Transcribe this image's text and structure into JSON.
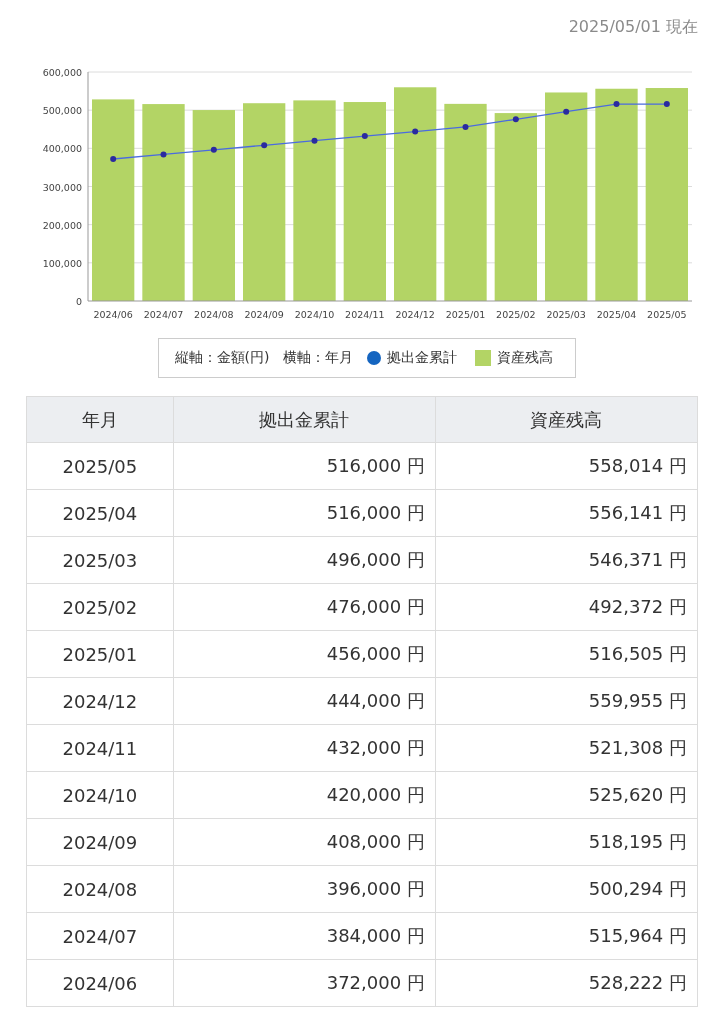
{
  "as_of": "2025/05/01 現在",
  "chart": {
    "chart_data": {
      "type": "bar",
      "categories": [
        "2024/06",
        "2024/07",
        "2024/08",
        "2024/09",
        "2024/10",
        "2024/11",
        "2024/12",
        "2025/01",
        "2025/02",
        "2025/03",
        "2025/04",
        "2025/05"
      ],
      "series": [
        {
          "name": "拠出金累計",
          "color": "#2a2aa0",
          "type": "line",
          "marker": true,
          "values": [
            372000,
            384000,
            396000,
            408000,
            420000,
            432000,
            444000,
            456000,
            476000,
            496000,
            516000,
            516000
          ]
        },
        {
          "name": "資産残高",
          "color": "#b3d465",
          "values": [
            528222,
            515964,
            500294,
            518195,
            525620,
            521308,
            559955,
            516505,
            492372,
            546371,
            556141,
            558014
          ]
        }
      ],
      "stacked": false,
      "grid": true,
      "ylim": [
        0,
        600000
      ],
      "yticks": [
        {
          "value": 0,
          "label": "0"
        },
        {
          "value": 100000,
          "label": "100,000"
        },
        {
          "value": 200000,
          "label": "200,000"
        },
        {
          "value": 300000,
          "label": "300,000"
        },
        {
          "value": 400000,
          "label": "400,000"
        },
        {
          "value": 500000,
          "label": "500,000"
        },
        {
          "value": 600000,
          "label": "600,000"
        }
      ]
    },
    "legend": {
      "notes": [
        "縦軸：金額(円)",
        "横軸：年月"
      ],
      "items": [
        {
          "kind": "dot",
          "color": "#1565c0"
        },
        {
          "kind": "square",
          "color": "#b3d465"
        }
      ]
    }
  },
  "table": {
    "columns": [
      "年月",
      "拠出金累計",
      "資産残高"
    ],
    "rows": [
      [
        "2025/05",
        "516,000 円",
        "558,014 円"
      ],
      [
        "2025/04",
        "516,000 円",
        "556,141 円"
      ],
      [
        "2025/03",
        "496,000 円",
        "546,371 円"
      ],
      [
        "2025/02",
        "476,000 円",
        "492,372 円"
      ],
      [
        "2025/01",
        "456,000 円",
        "516,505 円"
      ],
      [
        "2024/12",
        "444,000 円",
        "559,955 円"
      ],
      [
        "2024/11",
        "432,000 円",
        "521,308 円"
      ],
      [
        "2024/10",
        "420,000 円",
        "525,620 円"
      ],
      [
        "2024/09",
        "408,000 円",
        "518,195 円"
      ],
      [
        "2024/08",
        "396,000 円",
        "500,294 円"
      ],
      [
        "2024/07",
        "384,000 円",
        "515,964 円"
      ],
      [
        "2024/06",
        "372,000 円",
        "528,222 円"
      ]
    ]
  }
}
